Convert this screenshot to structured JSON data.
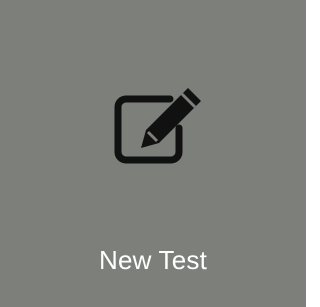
{
  "tile": {
    "label": "New Test",
    "icon": "edit-pencil-square-icon",
    "background_color": "#7d807a",
    "icon_color": "#111111",
    "text_color": "#ffffff"
  }
}
